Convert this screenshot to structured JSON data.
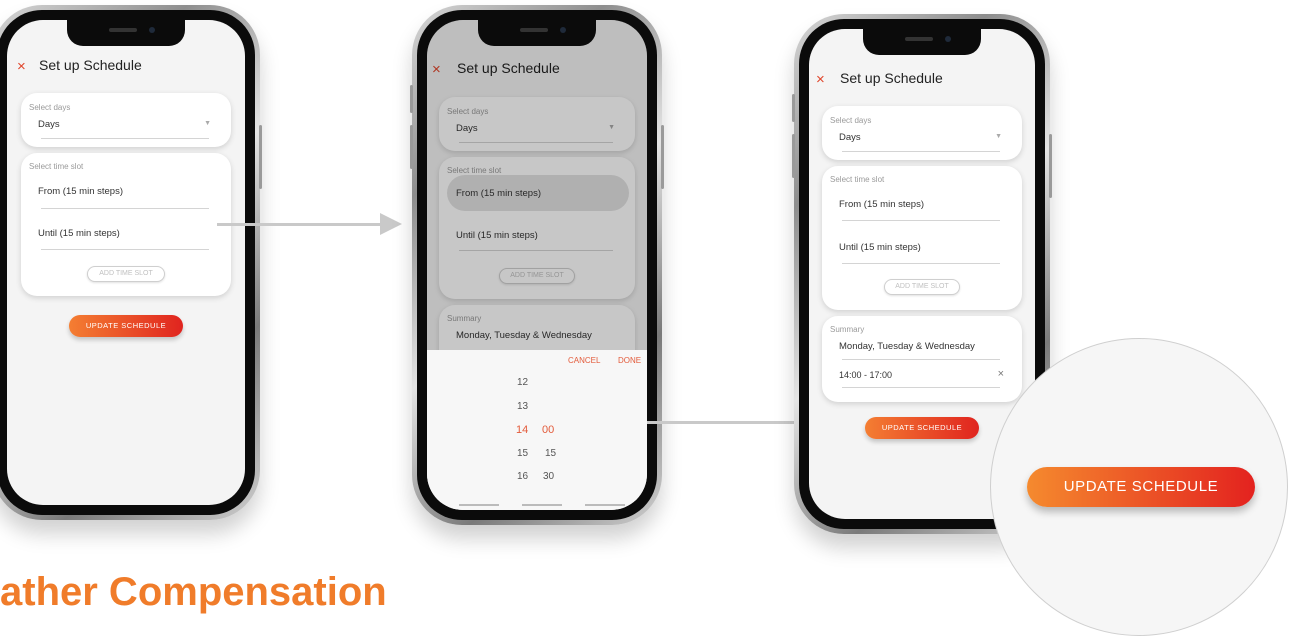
{
  "colors": {
    "accent": "#e0452b",
    "gradient_start": "#f47e32",
    "gradient_end": "#e0241f",
    "heading": "#f07c2a"
  },
  "heading": "ather Compensation",
  "screens": [
    {
      "close_icon": "×",
      "title": "Set up Schedule",
      "days_label": "Select days",
      "days_value": "Days",
      "time_label": "Select time slot",
      "from_text": "From (15 min steps)",
      "until_text": "Until (15 min steps)",
      "add_slot": "ADD TIME SLOT",
      "update": "UPDATE SCHEDULE"
    },
    {
      "close_icon": "×",
      "title": "Set up Schedule",
      "days_label": "Select days",
      "days_value": "Days",
      "time_label": "Select time slot",
      "from_text": "From (15 min steps)",
      "until_text": "Until (15 min steps)",
      "add_slot": "ADD TIME SLOT",
      "summary_label": "Summary",
      "summary_value": "Monday, Tuesday & Wednesday",
      "cancel": "CANCEL",
      "done": "DONE",
      "hours": [
        "12",
        "13",
        "14",
        "15",
        "16"
      ],
      "minutes": [
        "00",
        "15",
        "30"
      ],
      "selected_hour": "14",
      "selected_minute": "00"
    },
    {
      "close_icon": "×",
      "title": "Set up Schedule",
      "days_label": "Select days",
      "days_value": "Days",
      "time_label": "Select time slot",
      "from_text": "From (15 min steps)",
      "until_text": "Until (15 min steps)",
      "add_slot": "ADD TIME SLOT",
      "summary_label": "Summary",
      "summary_value": "Monday, Tuesday & Wednesday",
      "time_range": "14:00 - 17:00",
      "remove_icon": "×",
      "update": "UPDATE SCHEDULE"
    }
  ],
  "zoom_label": "UPDATE SCHEDULE"
}
